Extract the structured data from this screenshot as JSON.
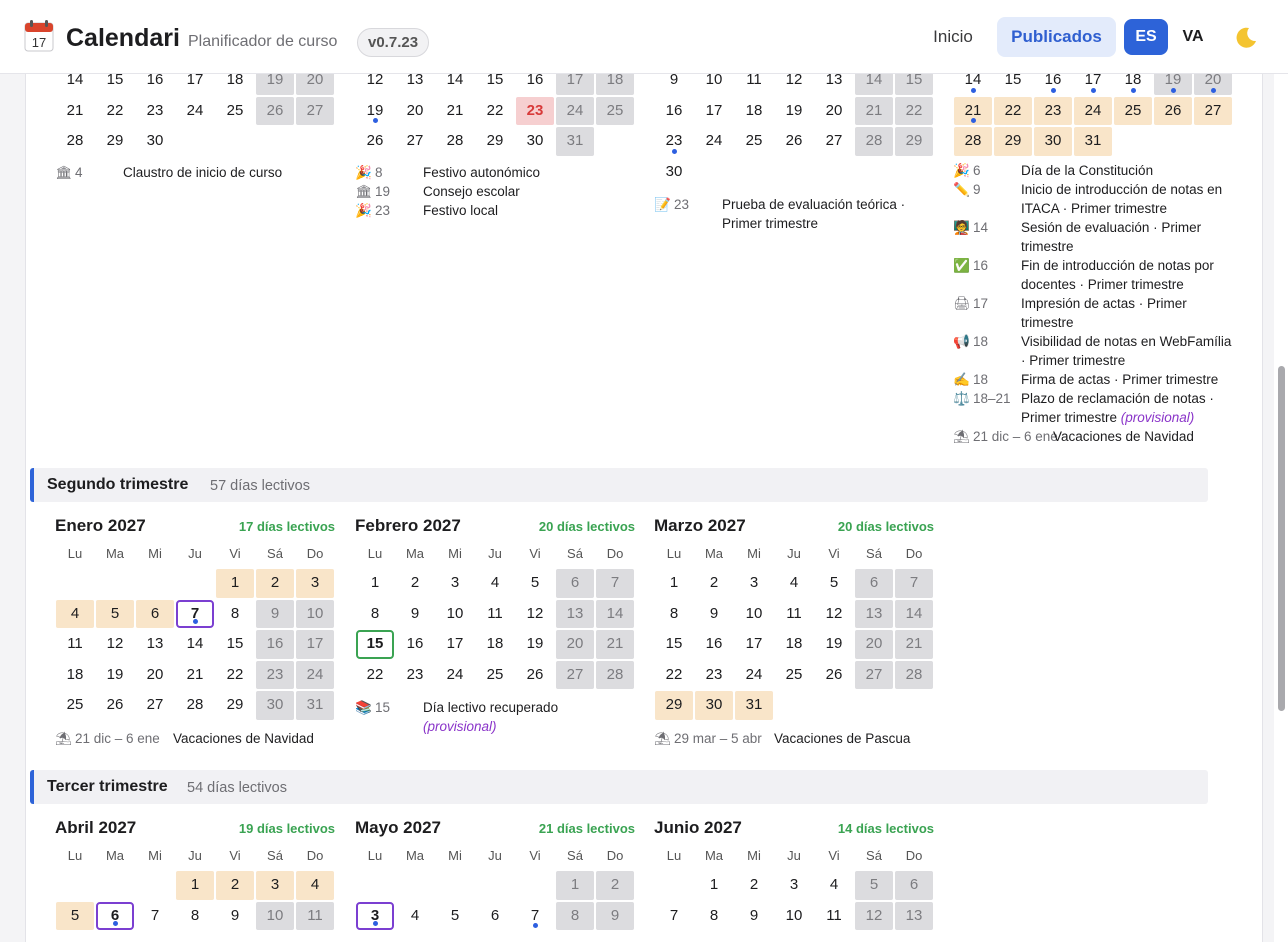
{
  "header": {
    "title": "Calendari",
    "subtitle": "Planificador de curso",
    "version": "v0.7.23",
    "nav_home": "Inicio",
    "nav_published": "Publicados",
    "lang_es": "ES",
    "lang_va": "VA",
    "logo_day": "17"
  },
  "dow": [
    "Lu",
    "Ma",
    "Mi",
    "Ju",
    "Vi",
    "Sá",
    "Do"
  ],
  "top_events": {
    "col1": [
      {
        "icon": "🏛",
        "date": "4",
        "text": "Claustro de inicio de curso"
      }
    ],
    "col2": [
      {
        "icon": "🎉",
        "date": "8",
        "text": "Festivo autonómico"
      },
      {
        "icon": "🏛",
        "date": "19",
        "text": "Consejo escolar"
      },
      {
        "icon": "🎉",
        "date": "23",
        "text": "Festivo local"
      }
    ],
    "col3": [
      {
        "icon": "📝",
        "date": "23",
        "text": "Prueba de evaluación teórica · Primer trimestre"
      }
    ],
    "col4": [
      {
        "icon": "🎉",
        "date": "6",
        "text": "Día de la Constitución"
      },
      {
        "icon": "✏️",
        "date": "9",
        "text": "Inicio de introducción de notas en ITACA · Primer trimestre"
      },
      {
        "icon": "🧑‍🏫",
        "date": "14",
        "text": "Sesión de evaluación · Primer trimestre"
      },
      {
        "icon": "✅",
        "date": "16",
        "text": "Fin de introducción de notas por docentes · Primer trimestre"
      },
      {
        "icon": "🖨",
        "date": "17",
        "text": "Impresión de actas · Primer trimestre"
      },
      {
        "icon": "📢",
        "date": "18",
        "text": "Visibilidad de notas en WebFamília · Primer trimestre"
      },
      {
        "icon": "✍️",
        "date": "18",
        "text": "Firma de actas · Primer trimestre"
      },
      {
        "icon": "⚖️",
        "date": "18–21",
        "text": "Plazo de reclamación de notas · Primer trimestre",
        "prov": "(provisional)"
      },
      {
        "icon": "⛱",
        "date": "21 dic – 6 ene",
        "text": "Vacaciones de Navidad"
      }
    ]
  },
  "trimesters": [
    {
      "name": "Segundo trimestre",
      "count": "57 días lectivos"
    },
    {
      "name": "Tercer trimestre",
      "count": "54 días lectivos"
    }
  ],
  "months": {
    "ene": {
      "name": "Enero 2027",
      "count": "17 días lectivos"
    },
    "feb": {
      "name": "Febrero 2027",
      "count": "20 días lectivos"
    },
    "mar": {
      "name": "Marzo 2027",
      "count": "20 días lectivos"
    },
    "abr": {
      "name": "Abril 2027",
      "count": "19 días lectivos"
    },
    "may": {
      "name": "Mayo 2027",
      "count": "21 días lectivos"
    },
    "jun": {
      "name": "Junio 2027",
      "count": "14 días lectivos"
    }
  },
  "mid_events": {
    "ene": [
      {
        "icon": "⛱",
        "date": "21 dic – 6 ene",
        "text": "Vacaciones de Navidad"
      }
    ],
    "feb": [
      {
        "icon": "📚",
        "date": "15",
        "text": "Día lectivo recuperado",
        "prov": "(provisional)"
      }
    ],
    "mar": [
      {
        "icon": "⛱",
        "date": "29 mar – 5 abr",
        "text": "Vacaciones de Pascua"
      }
    ]
  },
  "colors": {
    "accent": "#2d63d8",
    "lective": "#3aa352",
    "vacation": "#f9e5c9",
    "weekend": "#dcdcdf",
    "holiday": "#f6cfd0",
    "event": "#7b3fd1"
  }
}
